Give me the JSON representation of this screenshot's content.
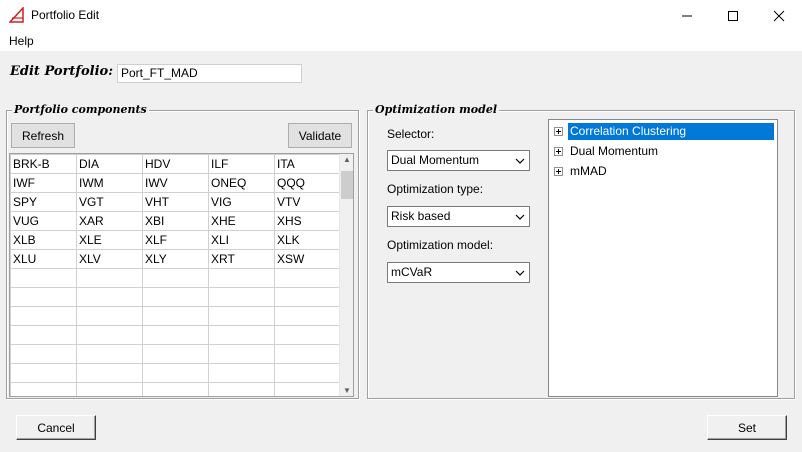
{
  "window": {
    "title": "Portfolio Edit",
    "icon": "app-triangle-icon"
  },
  "menu": {
    "help": "Help"
  },
  "edit_portfolio": {
    "label": "Edit Portfolio:",
    "value": "Port_FT_MAD"
  },
  "components": {
    "group_label": "Portfolio components",
    "refresh_label": "Refresh",
    "validate_label": "Validate",
    "grid": [
      [
        "BRK-B",
        "DIA",
        "HDV",
        "ILF",
        "ITA"
      ],
      [
        "IWF",
        "IWM",
        "IWV",
        "ONEQ",
        "QQQ"
      ],
      [
        "SPY",
        "VGT",
        "VHT",
        "VIG",
        "VTV"
      ],
      [
        "VUG",
        "XAR",
        "XBI",
        "XHE",
        "XHS"
      ],
      [
        "XLB",
        "XLE",
        "XLF",
        "XLI",
        "XLK"
      ],
      [
        "XLU",
        "XLV",
        "XLY",
        "XRT",
        "XSW"
      ],
      [
        "",
        "",
        "",
        "",
        ""
      ],
      [
        "",
        "",
        "",
        "",
        ""
      ],
      [
        "",
        "",
        "",
        "",
        ""
      ],
      [
        "",
        "",
        "",
        "",
        ""
      ],
      [
        "",
        "",
        "",
        "",
        ""
      ],
      [
        "",
        "",
        "",
        "",
        ""
      ],
      [
        "",
        "",
        "",
        "",
        ""
      ]
    ]
  },
  "optimization": {
    "group_label": "Optimization model",
    "selector_label": "Selector:",
    "selector_value": "Dual Momentum",
    "type_label": "Optimization type:",
    "type_value": "Risk based",
    "model_label": "Optimization model:",
    "model_value": "mCVaR",
    "tree": [
      {
        "label": "Correlation Clustering",
        "selected": true
      },
      {
        "label": "Dual Momentum",
        "selected": false
      },
      {
        "label": "mMAD",
        "selected": false
      }
    ]
  },
  "footer": {
    "cancel_label": "Cancel",
    "set_label": "Set"
  },
  "colors": {
    "selection": "#0078d7",
    "background": "#f0f0f0"
  }
}
